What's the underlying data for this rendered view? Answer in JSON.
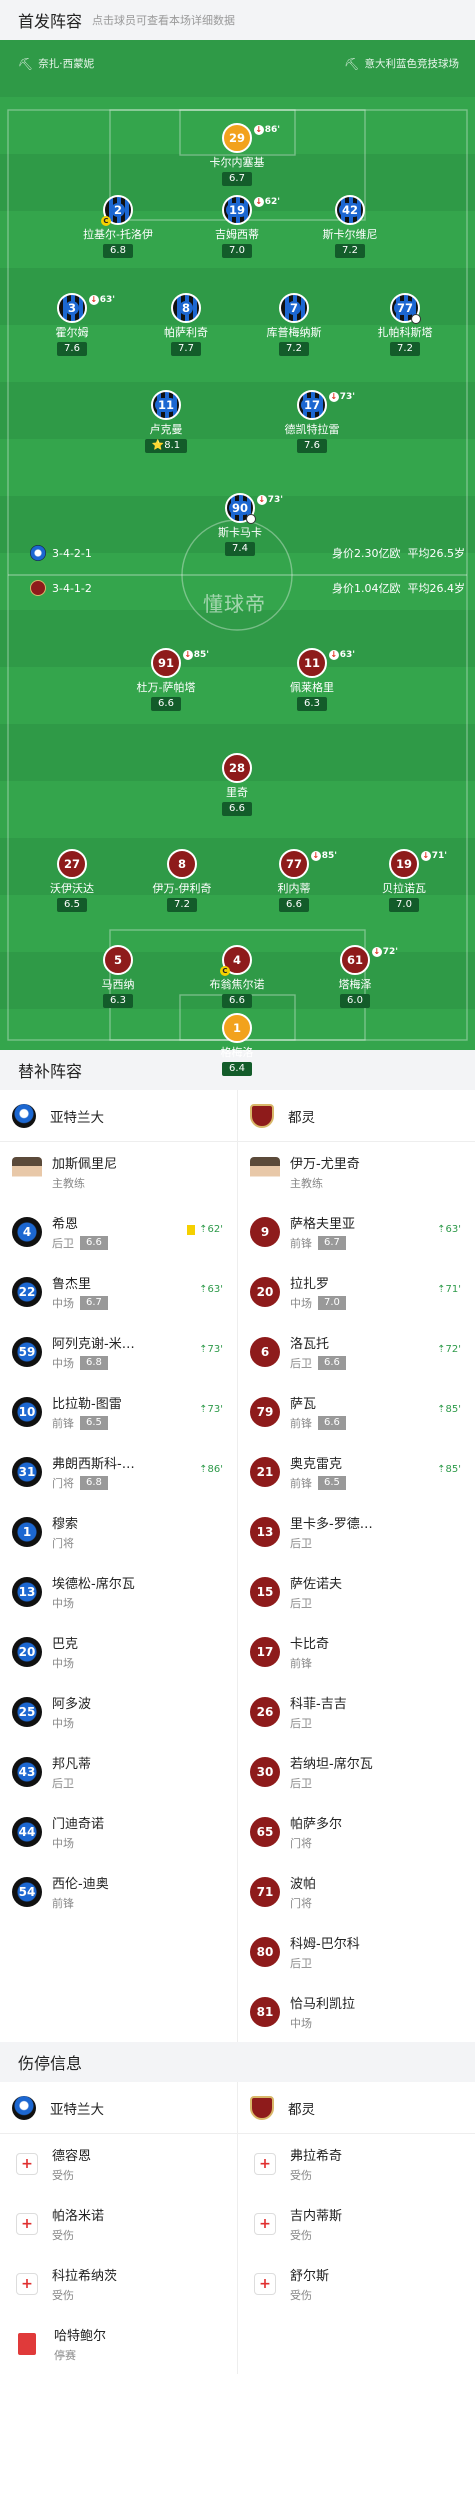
{
  "header": {
    "title": "首发阵容",
    "hint": "点击球员可查看本场详细数据"
  },
  "venue": {
    "left": "奈扎·西蒙妮",
    "right": "意大利蓝色竞技球场"
  },
  "watermark": "懂球帝",
  "atalanta": {
    "formation": "3-4-2-1",
    "value": "身价2.30亿欧",
    "age": "平均26.5岁",
    "players": [
      {
        "num": "29",
        "name": "卡尔内塞基",
        "rating": "6.7",
        "sub": "86'"
      },
      {
        "num": "2",
        "name": "拉基尔-托洛伊",
        "rating": "6.8"
      },
      {
        "num": "19",
        "name": "吉姆西蒂",
        "rating": "7.0",
        "sub": "62'"
      },
      {
        "num": "42",
        "name": "斯卡尔维尼",
        "rating": "7.2"
      },
      {
        "num": "3",
        "name": "霍尔姆",
        "rating": "7.6",
        "sub": "63'"
      },
      {
        "num": "8",
        "name": "帕萨利奇",
        "rating": "7.7"
      },
      {
        "num": "7",
        "name": "库普梅纳斯",
        "rating": "7.2"
      },
      {
        "num": "77",
        "name": "扎帕科斯塔",
        "rating": "7.2"
      },
      {
        "num": "11",
        "name": "卢克曼",
        "rating": "8.1"
      },
      {
        "num": "17",
        "name": "德凯特拉雷",
        "rating": "7.6",
        "sub": "73'"
      },
      {
        "num": "90",
        "name": "斯卡马卡",
        "rating": "7.4",
        "sub": "73'"
      }
    ]
  },
  "torino": {
    "formation": "3-4-1-2",
    "value": "身价1.04亿欧",
    "age": "平均26.4岁",
    "players": [
      {
        "num": "91",
        "name": "杜万-萨帕塔",
        "rating": "6.6",
        "sub": "85'"
      },
      {
        "num": "11",
        "name": "佩莱格里",
        "rating": "6.3",
        "sub": "63'"
      },
      {
        "num": "28",
        "name": "里奇",
        "rating": "6.6"
      },
      {
        "num": "27",
        "name": "沃伊沃达",
        "rating": "6.5"
      },
      {
        "num": "8",
        "name": "伊万-伊利奇",
        "rating": "7.2"
      },
      {
        "num": "77",
        "name": "利内蒂",
        "rating": "6.6",
        "sub": "85'"
      },
      {
        "num": "19",
        "name": "贝拉诺瓦",
        "rating": "7.0",
        "sub": "71'"
      },
      {
        "num": "5",
        "name": "马西纳",
        "rating": "6.3"
      },
      {
        "num": "4",
        "name": "布翁焦尔诺",
        "rating": "6.6"
      },
      {
        "num": "61",
        "name": "塔梅泽",
        "rating": "6.0",
        "sub": "72'"
      },
      {
        "num": "1",
        "name": "格梅洛",
        "rating": "6.4"
      }
    ]
  },
  "subs": {
    "title": "替补阵容",
    "team_left": "亚特兰大",
    "team_right": "都灵",
    "coach_left": {
      "name": "加斯佩里尼",
      "role": "主教练"
    },
    "coach_right": {
      "name": "伊万-尤里奇",
      "role": "主教练"
    },
    "left": [
      {
        "num": "4",
        "name": "希恩",
        "pos": "后卫",
        "rating": "6.6",
        "time": "62'",
        "yellow": true
      },
      {
        "num": "22",
        "name": "鲁杰里",
        "pos": "中场",
        "rating": "6.7",
        "time": "63'"
      },
      {
        "num": "59",
        "name": "阿列克谢-米…",
        "pos": "中场",
        "rating": "6.8",
        "time": "73'"
      },
      {
        "num": "10",
        "name": "比拉勒-图雷",
        "pos": "前锋",
        "rating": "6.5",
        "time": "73'"
      },
      {
        "num": "31",
        "name": "弗朗西斯科-…",
        "pos": "门将",
        "rating": "6.8",
        "time": "86'"
      },
      {
        "num": "1",
        "name": "穆索",
        "pos": "门将"
      },
      {
        "num": "13",
        "name": "埃德松-席尔瓦",
        "pos": "中场"
      },
      {
        "num": "20",
        "name": "巴克",
        "pos": "中场"
      },
      {
        "num": "25",
        "name": "阿多波",
        "pos": "中场"
      },
      {
        "num": "43",
        "name": "邦凡蒂",
        "pos": "后卫"
      },
      {
        "num": "44",
        "name": "门迪奇诺",
        "pos": "中场"
      },
      {
        "num": "54",
        "name": "西伦-迪奥",
        "pos": "前锋"
      }
    ],
    "right": [
      {
        "num": "9",
        "name": "萨格夫里亚",
        "pos": "前锋",
        "rating": "6.7",
        "time": "63'"
      },
      {
        "num": "20",
        "name": "拉扎罗",
        "pos": "中场",
        "rating": "7.0",
        "time": "71'"
      },
      {
        "num": "6",
        "name": "洛瓦托",
        "pos": "后卫",
        "rating": "6.6",
        "time": "72'"
      },
      {
        "num": "79",
        "name": "萨瓦",
        "pos": "前锋",
        "rating": "6.6",
        "time": "85'"
      },
      {
        "num": "21",
        "name": "奥克雷克",
        "pos": "前锋",
        "rating": "6.5",
        "time": "85'"
      },
      {
        "num": "13",
        "name": "里卡多-罗德…",
        "pos": "后卫"
      },
      {
        "num": "15",
        "name": "萨佐诺夫",
        "pos": "后卫"
      },
      {
        "num": "17",
        "name": "卡比奇",
        "pos": "前锋"
      },
      {
        "num": "26",
        "name": "科菲-吉吉",
        "pos": "后卫"
      },
      {
        "num": "30",
        "name": "若纳坦-席尔瓦",
        "pos": "后卫"
      },
      {
        "num": "65",
        "name": "帕萨多尔",
        "pos": "门将"
      },
      {
        "num": "71",
        "name": "波帕",
        "pos": "门将"
      },
      {
        "num": "80",
        "name": "科姆-巴尔科",
        "pos": "后卫"
      },
      {
        "num": "81",
        "name": "恰马利凯拉",
        "pos": "中场"
      }
    ]
  },
  "injuries": {
    "title": "伤停信息",
    "team_left": "亚特兰大",
    "team_right": "都灵",
    "left": [
      {
        "name": "德容恩",
        "status": "受伤",
        "type": "inj"
      },
      {
        "name": "帕洛米诺",
        "status": "受伤",
        "type": "inj"
      },
      {
        "name": "科拉希纳茨",
        "status": "受伤",
        "type": "inj"
      },
      {
        "name": "哈特鲍尔",
        "status": "停赛",
        "type": "red"
      }
    ],
    "right": [
      {
        "name": "弗拉希奇",
        "status": "受伤",
        "type": "inj"
      },
      {
        "name": "吉内蒂斯",
        "status": "受伤",
        "type": "inj"
      },
      {
        "name": "舒尔斯",
        "status": "受伤",
        "type": "inj"
      }
    ]
  }
}
